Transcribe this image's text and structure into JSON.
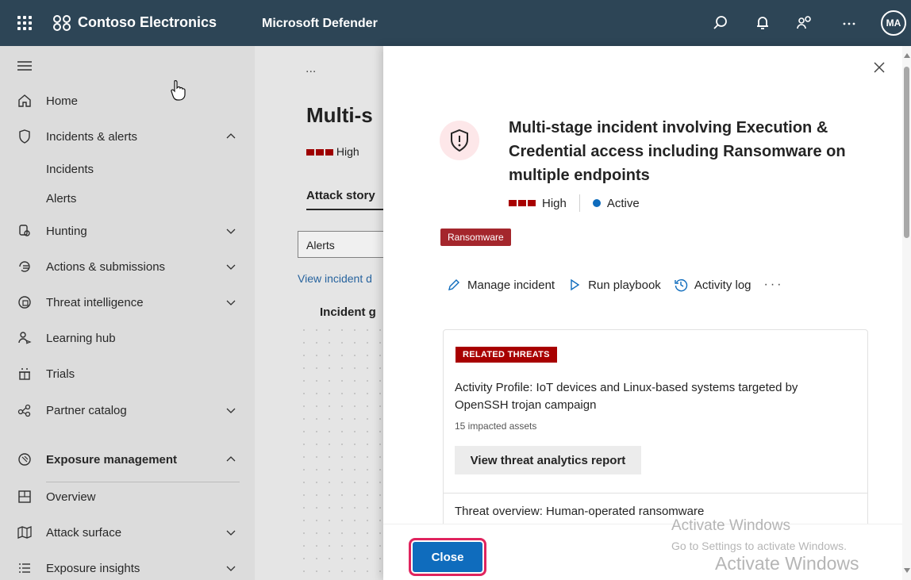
{
  "topbar": {
    "org_name": "Contoso Electronics",
    "app_name": "Microsoft Defender",
    "avatar_initials": "MA",
    "icons": [
      "app-launcher-icon",
      "org-logo-icon",
      "search-icon",
      "notification-bell-icon",
      "share-icon",
      "more-icon"
    ],
    "background_color": "#2d4556"
  },
  "sidebar": {
    "items": [
      {
        "label": "Home",
        "icon": "home-icon"
      },
      {
        "label": "Incidents & alerts",
        "icon": "shield-icon",
        "expanded": true
      },
      {
        "label": "Incidents"
      },
      {
        "label": "Alerts"
      },
      {
        "label": "Hunting",
        "icon": "hunting-icon"
      },
      {
        "label": "Actions & submissions",
        "icon": "actions-icon"
      },
      {
        "label": "Threat intelligence",
        "icon": "threat-intel-icon"
      },
      {
        "label": "Learning hub",
        "icon": "learning-icon"
      },
      {
        "label": "Trials",
        "icon": "trials-icon"
      },
      {
        "label": "Partner catalog",
        "icon": "partner-icon"
      },
      {
        "label": "Exposure management",
        "icon": "exposure-icon",
        "expanded": true
      },
      {
        "label": "Overview",
        "icon": "overview-icon"
      },
      {
        "label": "Attack surface",
        "icon": "map-icon"
      },
      {
        "label": "Exposure insights",
        "icon": "insights-icon"
      }
    ]
  },
  "main": {
    "more": "...",
    "title": "Multi-s",
    "severity": "High",
    "tab": "Attack story",
    "filter": "Alerts",
    "link": "View incident d",
    "graph_title": "Incident g"
  },
  "panel": {
    "title": "Multi-stage incident involving Execution & Credential access including Ransomware on multiple endpoints",
    "severity": "High",
    "status": "Active",
    "tag": "Ransomware",
    "actions": {
      "manage": "Manage incident",
      "playbook": "Run playbook",
      "activity": "Activity log",
      "more": "···"
    },
    "related_threats": {
      "badge": "RELATED THREATS",
      "title": "Activity Profile: IoT devices and Linux-based systems targeted by OpenSSH trojan campaign",
      "impacted": "15 impacted assets",
      "button": "View threat analytics report",
      "overview": "Threat overview: Human-operated ransomware"
    },
    "close_label": "Close",
    "severity_color": "#a80000",
    "active_color": "#0f6cbd"
  },
  "watermark": {
    "line1": "Activate Windows",
    "line2": "Go to Settings to activate Windows.",
    "line3": "Activate Windows"
  }
}
